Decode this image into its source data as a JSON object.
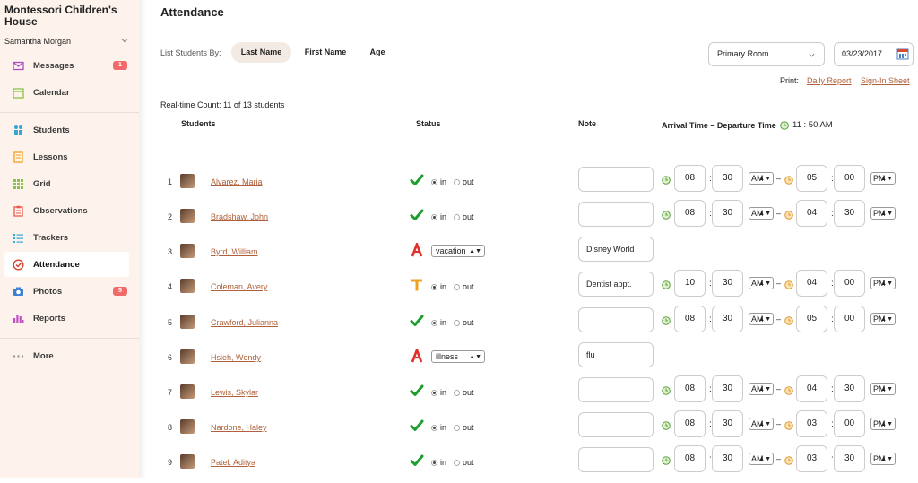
{
  "sidebar": {
    "school_name": "Montessori Children's House",
    "user_name": "Samantha Morgan",
    "nav": [
      {
        "label": "Messages",
        "icon": "envelope-icon",
        "badge": "1"
      },
      {
        "label": "Calendar",
        "icon": "calendar-icon"
      },
      {
        "label": "Students",
        "icon": "students-icon"
      },
      {
        "label": "Lessons",
        "icon": "lessons-icon"
      },
      {
        "label": "Grid",
        "icon": "grid-icon"
      },
      {
        "label": "Observations",
        "icon": "clipboard-icon"
      },
      {
        "label": "Trackers",
        "icon": "list-icon"
      },
      {
        "label": "Attendance",
        "icon": "check-circle-icon",
        "active": true
      },
      {
        "label": "Photos",
        "icon": "camera-icon",
        "badge": "5"
      },
      {
        "label": "Reports",
        "icon": "bar-chart-icon"
      },
      {
        "label": "More",
        "icon": "ellipsis-icon"
      }
    ]
  },
  "header": {
    "title": "Attendance"
  },
  "filters": {
    "list_by_label": "List Students By:",
    "sort_options": [
      "Last Name",
      "First Name",
      "Age"
    ],
    "selected_sort": "Last Name",
    "room": "Primary Room",
    "date": "03/23/2017"
  },
  "print": {
    "label": "Print:",
    "daily_report": "Daily Report",
    "sign_in_sheet": "Sign-In Sheet"
  },
  "realtime_count": "Real-time Count: 11 of 13 students",
  "columns": {
    "students": "Students",
    "status": "Status",
    "note": "Note",
    "times": "Arrival Time – Departure Time",
    "current_time": "11 : 50 AM"
  },
  "status_labels": {
    "in": "in",
    "out": "out"
  },
  "colors": {
    "accent_link": "#b0603a",
    "present_check": "#1e9e2e",
    "absent": "#e0302c",
    "tardy": "#f0a020",
    "badge": "#f06a6a",
    "sidebar_bg": "#fdf3ec"
  },
  "students": [
    {
      "num": "1",
      "name": "Alvarez, Maria",
      "status": "in",
      "note": "",
      "arr_h": "08",
      "arr_m": "30",
      "arr_ap": "AM",
      "dep_h": "05",
      "dep_m": "00",
      "dep_ap": "PM"
    },
    {
      "num": "2",
      "name": "Bradshaw, John",
      "status": "in",
      "note": "",
      "arr_h": "08",
      "arr_m": "30",
      "arr_ap": "AM",
      "dep_h": "04",
      "dep_m": "30",
      "dep_ap": "PM"
    },
    {
      "num": "3",
      "name": "Byrd, William",
      "status": "absent",
      "absence": "vacation",
      "note": "Disney World"
    },
    {
      "num": "4",
      "name": "Coleman, Avery",
      "status": "tardy",
      "note": "Dentist appt.",
      "arr_h": "10",
      "arr_m": "30",
      "arr_ap": "AM",
      "dep_h": "04",
      "dep_m": "00",
      "dep_ap": "PM"
    },
    {
      "num": "5",
      "name": "Crawford, Julianna",
      "status": "in",
      "note": "",
      "arr_h": "08",
      "arr_m": "30",
      "arr_ap": "AM",
      "dep_h": "05",
      "dep_m": "00",
      "dep_ap": "PM"
    },
    {
      "num": "6",
      "name": "Hsieh, Wendy",
      "status": "absent",
      "absence": "illness",
      "note": "flu"
    },
    {
      "num": "7",
      "name": "Lewis, Skylar",
      "status": "in",
      "note": "",
      "arr_h": "08",
      "arr_m": "30",
      "arr_ap": "AM",
      "dep_h": "04",
      "dep_m": "30",
      "dep_ap": "PM"
    },
    {
      "num": "8",
      "name": "Nardone, Haley",
      "status": "in",
      "note": "",
      "arr_h": "08",
      "arr_m": "30",
      "arr_ap": "AM",
      "dep_h": "03",
      "dep_m": "00",
      "dep_ap": "PM"
    },
    {
      "num": "9",
      "name": "Patel, Aditya",
      "status": "in",
      "note": "",
      "arr_h": "08",
      "arr_m": "30",
      "arr_ap": "AM",
      "dep_h": "03",
      "dep_m": "30",
      "dep_ap": "PM"
    }
  ]
}
